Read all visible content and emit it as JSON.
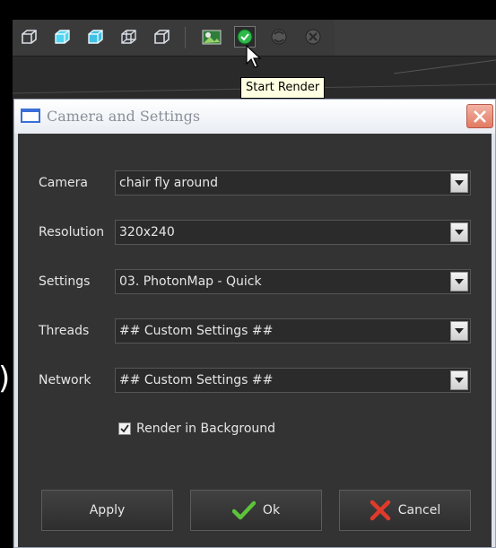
{
  "toolbar": {
    "icons": [
      "cube-wireframe-icon",
      "cube-solid-icon",
      "cube-solid-alt-icon",
      "cube-outline-icon",
      "cube-outline-alt-icon",
      "render-region-icon",
      "start-render-icon",
      "render-sequence-icon",
      "stop-render-icon"
    ]
  },
  "tooltip": {
    "text": "Start Render"
  },
  "dialog": {
    "title": "Camera and Settings",
    "fields": [
      {
        "label": "Camera",
        "value": "chair fly around"
      },
      {
        "label": "Resolution",
        "value": "320x240"
      },
      {
        "label": "Settings",
        "value": "03. PhotonMap - Quick"
      },
      {
        "label": "Threads",
        "value": "## Custom Settings ##"
      },
      {
        "label": "Network",
        "value": "## Custom Settings ##"
      }
    ],
    "render_in_background": {
      "label": "Render in Background",
      "checked": true
    },
    "buttons": {
      "apply": "Apply",
      "ok": "Ok",
      "cancel": "Cancel"
    }
  },
  "edge_glyph": ")"
}
